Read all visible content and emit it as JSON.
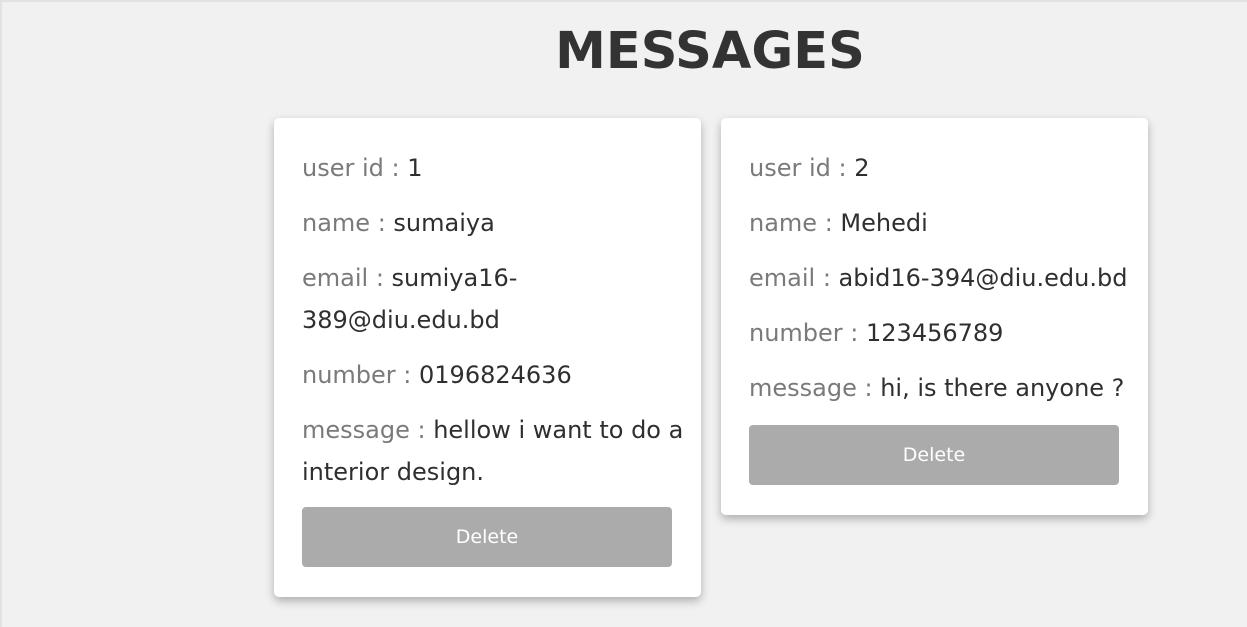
{
  "page": {
    "title": "MESSAGES"
  },
  "messages": [
    {
      "user_id_label": "user id : ",
      "user_id": "1",
      "name_label": "name : ",
      "name": "sumaiya",
      "email_label": "email : ",
      "email": "sumiya16-389@diu.edu.bd",
      "number_label": "number : ",
      "number": "0196824636",
      "message_label": "message : ",
      "message": "hellow i want to do a interior design.",
      "delete_label": "Delete"
    },
    {
      "user_id_label": "user id : ",
      "user_id": "2",
      "name_label": "name : ",
      "name": "Mehedi",
      "email_label": "email : ",
      "email": "abid16-394@diu.edu.bd",
      "number_label": "number : ",
      "number": "123456789",
      "message_label": "message : ",
      "message": "hi, is there anyone ?",
      "delete_label": "Delete"
    }
  ]
}
